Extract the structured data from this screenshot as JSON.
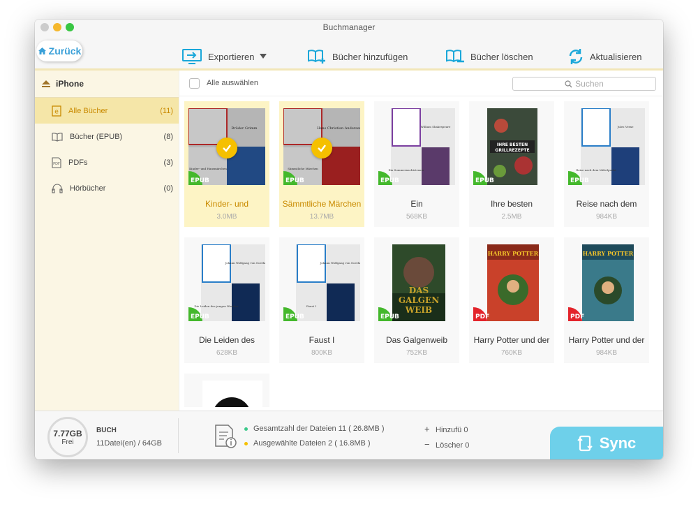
{
  "window": {
    "title": "Buchmanager"
  },
  "toolbar": {
    "back_label": "Zurück",
    "export_label": "Exportieren",
    "add_label": "Bücher hinzufügen",
    "delete_label": "Bücher löschen",
    "refresh_label": "Aktualisieren"
  },
  "sidebar": {
    "device": "iPhone",
    "items": [
      {
        "label": "Alle Bücher",
        "count": "(11)",
        "icon": "ebook-icon"
      },
      {
        "label": "Bücher (EPUB)",
        "count": "(8)",
        "icon": "open-book-icon"
      },
      {
        "label": "PDFs",
        "count": "(3)",
        "icon": "pdf-file-icon"
      },
      {
        "label": "Hörbücher",
        "count": "(0)",
        "icon": "audiobook-icon"
      }
    ]
  },
  "main": {
    "select_all_label": "Alle auswählen",
    "search_placeholder": "Suchen",
    "books": [
      {
        "title": "Kinder- und",
        "size": "3.0MB",
        "format": "EPUB",
        "selected": true
      },
      {
        "title": "Sämmtliche Märchen",
        "size": "13.7MB",
        "format": "EPUB",
        "selected": true
      },
      {
        "title": "Ein",
        "size": "568KB",
        "format": "EPUB",
        "selected": false
      },
      {
        "title": "Ihre besten",
        "size": "2.5MB",
        "format": "EPUB",
        "selected": false
      },
      {
        "title": "Reise nach dem",
        "size": "984KB",
        "format": "EPUB",
        "selected": false
      },
      {
        "title": "Die Leiden des",
        "size": "628KB",
        "format": "EPUB",
        "selected": false
      },
      {
        "title": "Faust I",
        "size": "800KB",
        "format": "EPUB",
        "selected": false
      },
      {
        "title": "Das Galgenweib",
        "size": "752KB",
        "format": "EPUB",
        "selected": false
      },
      {
        "title": "Harry Potter und der",
        "size": "760KB",
        "format": "PDF",
        "selected": false
      },
      {
        "title": "Harry Potter und der",
        "size": "984KB",
        "format": "PDF",
        "selected": false
      },
      {
        "title": "",
        "size": "",
        "format": "",
        "selected": false
      }
    ]
  },
  "footer": {
    "storage_free": "7.77GB",
    "storage_free_label": "Frei",
    "category": "BUCH",
    "storage_usage": "11Datei(en) / 64GB",
    "total_files": "Gesamtzahl der Dateien 11 ( 26.8MB )",
    "selected_files": "Ausgewählte Dateien 2 ( 16.8MB )",
    "added": "Hinzufü 0",
    "removed": "Löscher 0",
    "sync_label": "Sync"
  },
  "colors": {
    "accent": "#c98a00",
    "selected_bg": "#fdf4c5",
    "epub_badge": "#44b82c",
    "pdf_badge": "#e3242b",
    "sync_bg": "#6ed0ea",
    "blue_icon": "#1aa7d9"
  }
}
